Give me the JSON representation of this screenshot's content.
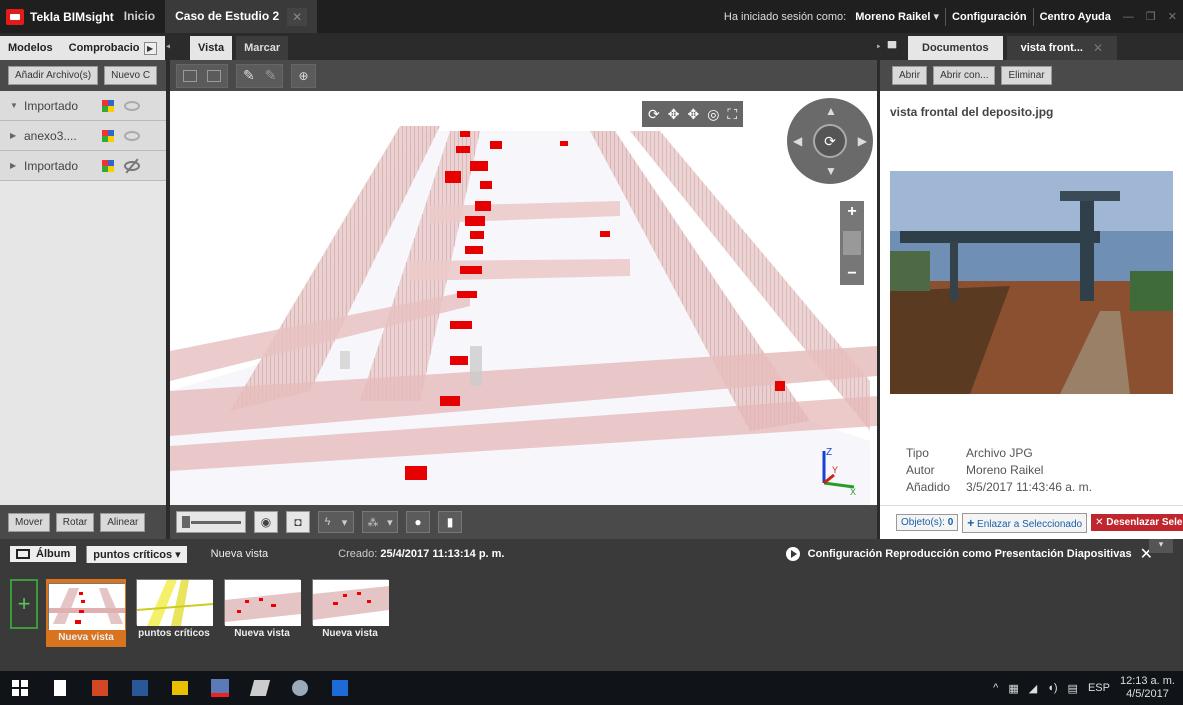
{
  "titlebar": {
    "app_name": "Tekla BIMsight",
    "tab_inicio": "Inicio",
    "tab_project": "Caso de Estudio 2",
    "session_label": "Ha iniciado sesión como:",
    "user": "Moreno Raikel",
    "config": "Configuración",
    "help": "Centro Ayuda"
  },
  "left_panel": {
    "tab_models": "Modelos",
    "tab_checks": "Comprobacio",
    "btn_add_files": "Añadir Archivo(s)",
    "btn_new": "Nuevo C",
    "models": [
      {
        "name": "Importado",
        "expanded": true,
        "visible": true
      },
      {
        "name": "anexo3....",
        "expanded": false,
        "visible": true
      },
      {
        "name": "Importado",
        "expanded": false,
        "visible": false
      }
    ],
    "btn_move": "Mover",
    "btn_rotate": "Rotar",
    "btn_align": "Alinear"
  },
  "center": {
    "tab_view": "Vista",
    "tab_mark": "Marcar"
  },
  "right_panel": {
    "tab_documents": "Documentos",
    "tab_active": "vista front...",
    "btn_open": "Abrir",
    "btn_open_with": "Abrir con...",
    "btn_delete": "Eliminar",
    "doc_title": "vista frontal del deposito.jpg",
    "meta": {
      "type_label": "Tipo",
      "type_value": "Archivo JPG",
      "author_label": "Autor",
      "author_value": "Moreno Raikel",
      "added_label": "Añadido",
      "added_value": "3/5/2017 11:43:46 a. m."
    },
    "objects_label": "Objeto(s):",
    "objects_count": "0",
    "btn_link": "Enlazar a Seleccionado",
    "btn_unlink": "Desenlazar Selec"
  },
  "album": {
    "album_label": "Álbum",
    "album_selected": "puntos críticos",
    "current_view": "Nueva vista",
    "created_label": "Creado:",
    "created_value": "25/4/2017 11:13:14 p. m.",
    "playback_config": "Configuración Reproducción como Presentación Diapositivas",
    "thumbnails": [
      {
        "caption": "Nueva vista",
        "selected": true
      },
      {
        "caption": "puntos críticos",
        "selected": false
      },
      {
        "caption": "Nueva vista",
        "selected": false
      },
      {
        "caption": "Nueva vista",
        "selected": false
      }
    ]
  },
  "taskbar": {
    "lang": "ESP",
    "time": "12:13 a. m.",
    "date": "4/5/2017"
  },
  "colors": {
    "accent_orange": "#d8731f",
    "unlink_red": "#c0262d",
    "model_red": "#e21b1b"
  }
}
